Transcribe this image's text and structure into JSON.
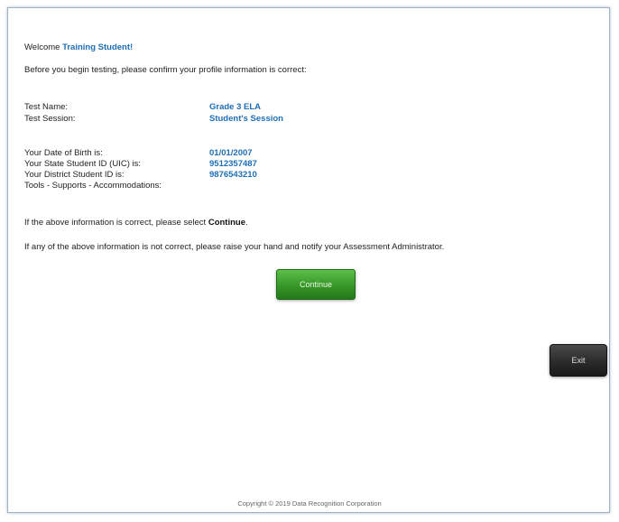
{
  "welcome": {
    "prefix": "Welcome",
    "student_name": "Training Student!"
  },
  "intro": "Before you begin testing, please confirm your profile information is correct:",
  "test_info": {
    "name_label": "Test Name:",
    "name_value": "Grade 3 ELA",
    "session_label": "Test Session:",
    "session_value": "Student's Session"
  },
  "student_info": {
    "dob_label": "Your Date of Birth is:",
    "dob_value": "01/01/2007",
    "state_id_label": "Your State Student ID (UIC) is:",
    "state_id_value": "9512357487",
    "district_id_label": "Your District Student ID is:",
    "district_id_value": "9876543210",
    "tools_label": "Tools - Supports - Accommodations:"
  },
  "instructions": {
    "correct_prefix": "If the above information is correct, please select",
    "correct_action": "Continue",
    "incorrect": "If any of the above information is not correct, please raise your hand and notify your Assessment Administrator."
  },
  "buttons": {
    "continue_label": "Continue",
    "exit_label": "Exit"
  },
  "footer": {
    "copyright": "Copyright © 2019 Data Recognition Corporation"
  }
}
